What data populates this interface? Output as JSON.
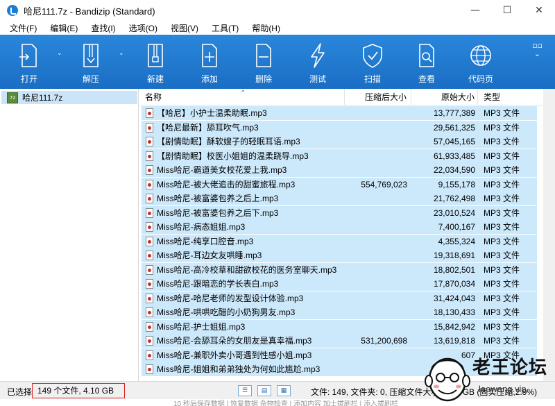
{
  "window": {
    "title": "哈尼111.7z - Bandizip (Standard)",
    "controls": [
      "—",
      "☐",
      "✕"
    ]
  },
  "menu": [
    "文件(F)",
    "编辑(E)",
    "查找(I)",
    "选项(O)",
    "视图(V)",
    "工具(T)",
    "帮助(H)"
  ],
  "toolbar": {
    "open": "打开",
    "extract": "解压",
    "new": "新建",
    "add": "添加",
    "delete": "删除",
    "test": "测试",
    "scan": "扫描",
    "view": "查看",
    "codepage": "代码页"
  },
  "tree": {
    "root": "哈尼111.7z"
  },
  "columns": {
    "name": "名称",
    "compressed": "压缩后大小",
    "original": "原始大小",
    "type": "类型"
  },
  "files": [
    {
      "name": "【哈尼】小护士温柔助眠.mp3",
      "compressed": "",
      "original": "13,777,389",
      "type": "MP3 文件"
    },
    {
      "name": "【哈尼最新】舔耳吹气.mp3",
      "compressed": "",
      "original": "29,561,325",
      "type": "MP3 文件"
    },
    {
      "name": "【剧情助眠】酥软嫂子的轻眠耳语.mp3",
      "compressed": "",
      "original": "57,045,165",
      "type": "MP3 文件"
    },
    {
      "name": "【剧情助眠】校医小姐姐的温柔跷导.mp3",
      "compressed": "",
      "original": "61,933,485",
      "type": "MP3 文件"
    },
    {
      "name": "Miss哈尼-霸道美女校花爱上我.mp3",
      "compressed": "",
      "original": "22,034,590",
      "type": "MP3 文件"
    },
    {
      "name": "Miss哈尼-被大佬追击的甜蜜旅程.mp3",
      "compressed": "554,769,023",
      "original": "9,155,178",
      "type": "MP3 文件"
    },
    {
      "name": "Miss哈尼-被富婆包养之后上.mp3",
      "compressed": "",
      "original": "21,762,498",
      "type": "MP3 文件"
    },
    {
      "name": "Miss哈尼-被富婆包养之后下.mp3",
      "compressed": "",
      "original": "23,010,524",
      "type": "MP3 文件"
    },
    {
      "name": "Miss哈尼-病态姐姐.mp3",
      "compressed": "",
      "original": "7,400,167",
      "type": "MP3 文件"
    },
    {
      "name": "Miss哈尼-纯享口腔音.mp3",
      "compressed": "",
      "original": "4,355,324",
      "type": "MP3 文件"
    },
    {
      "name": "Miss哈尼-耳边女友哄睡.mp3",
      "compressed": "",
      "original": "19,318,691",
      "type": "MP3 文件"
    },
    {
      "name": "Miss哈尼-高冷校草和甜欲校花的医务室聊天.mp3",
      "compressed": "",
      "original": "18,802,501",
      "type": "MP3 文件"
    },
    {
      "name": "Miss哈尼-跟暗恋的学长表白.mp3",
      "compressed": "",
      "original": "17,870,034",
      "type": "MP3 文件"
    },
    {
      "name": "Miss哈尼-哈尼老师的发型设计体验.mp3",
      "compressed": "",
      "original": "31,424,043",
      "type": "MP3 文件"
    },
    {
      "name": "Miss哈尼-哄哄吃醋的小奶狗男友.mp3",
      "compressed": "",
      "original": "18,130,433",
      "type": "MP3 文件"
    },
    {
      "name": "Miss哈尼-护士姐姐.mp3",
      "compressed": "",
      "original": "15,842,942",
      "type": "MP3 文件"
    },
    {
      "name": "Miss哈尼-会舔耳朵的女朋友是真幸福.mp3",
      "compressed": "531,200,698",
      "original": "13,619,818",
      "type": "MP3 文件"
    },
    {
      "name": "Miss哈尼-兼职外卖小哥遇到性感小姐.mp3",
      "compressed": "",
      "original": "607",
      "type": "MP3 文件"
    },
    {
      "name": "Miss哈尼-姐姐和弟弟独处为何如此尴尬.mp3",
      "compressed": "",
      "original": "",
      "type": ""
    }
  ],
  "status": {
    "prefix": "已选择",
    "selection": "149 个文件, 4.10 GB",
    "summary": "文件: 149, 文件夹: 0, 压缩文件大小: 3.99 GB (固实压缩,2.9%)"
  },
  "watermark": {
    "title": "老王论坛",
    "url": "laowang.vip"
  },
  "bottom_text": "10 秒后保存数据 | 恢复数据    杂物检查 | 添加内容    加士拔刷栏 | 添入拔刷栏"
}
